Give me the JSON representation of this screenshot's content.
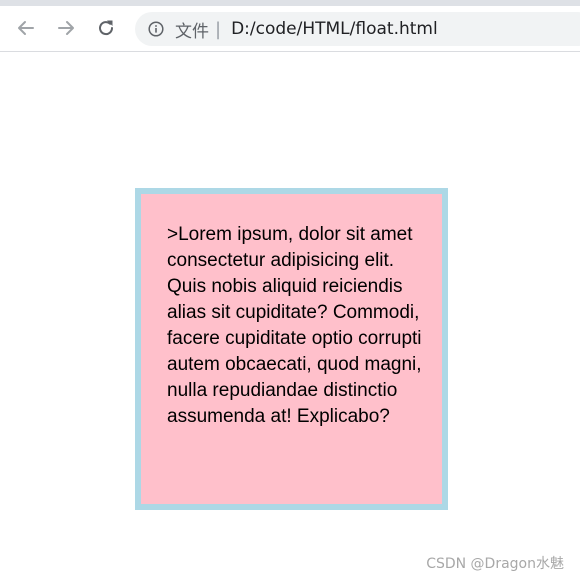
{
  "browser": {
    "address_bar": {
      "scheme_label": "文件",
      "separator": "|",
      "url": "D:/code/HTML/float.html"
    }
  },
  "page": {
    "paragraph": ">Lorem ipsum, dolor sit amet consectetur adipisicing elit. Quis nobis aliquid reiciendis alias sit cupiditate? Commodi, facere cupiditate optio corrupti autem obcaecati, quod magni, nulla repudiandae distinctio assumenda at! Explicabo?",
    "box_background": "#ffc0cb",
    "box_border": "#add8e6"
  },
  "watermark": "CSDN @Dragon水魅",
  "icons": [
    "back-arrow-icon",
    "forward-arrow-icon",
    "reload-icon",
    "info-icon"
  ]
}
